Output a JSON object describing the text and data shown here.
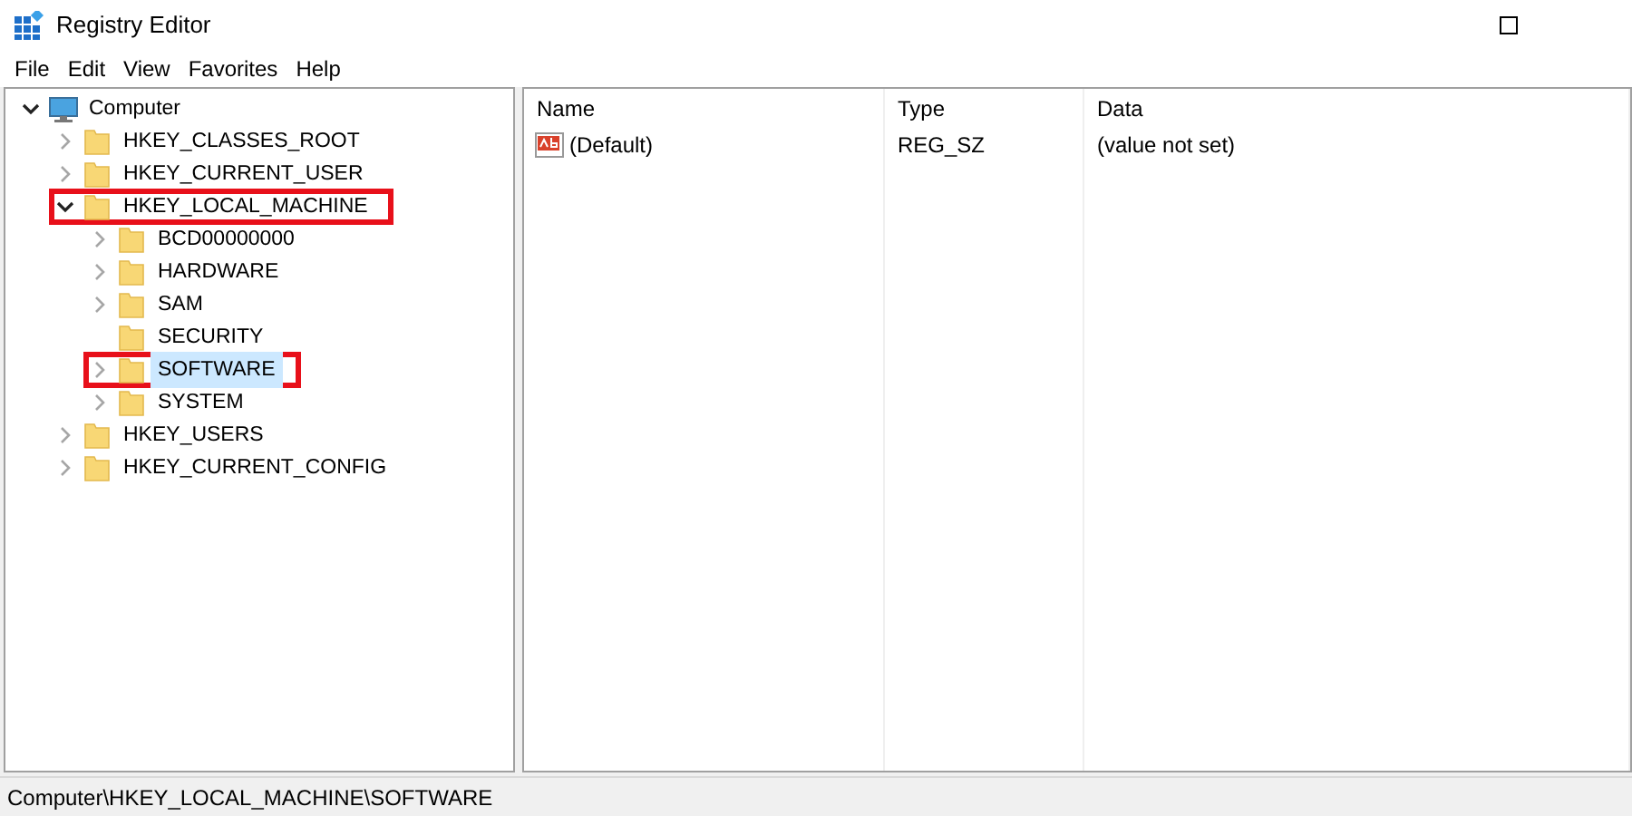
{
  "window": {
    "title": "Registry Editor"
  },
  "menu": [
    "File",
    "Edit",
    "View",
    "Favorites",
    "Help"
  ],
  "tree": [
    {
      "label": "Computer",
      "kind": "computer",
      "expanded": true,
      "selected": false,
      "highlighted": false,
      "children": [
        {
          "label": "HKEY_CLASSES_ROOT",
          "kind": "folder",
          "expanded": false,
          "selected": false,
          "highlighted": false
        },
        {
          "label": "HKEY_CURRENT_USER",
          "kind": "folder",
          "expanded": false,
          "selected": false,
          "highlighted": false
        },
        {
          "label": "HKEY_LOCAL_MACHINE",
          "kind": "folder",
          "expanded": true,
          "selected": false,
          "highlighted": true,
          "children": [
            {
              "label": "BCD00000000",
              "kind": "folder",
              "expanded": false,
              "selected": false,
              "highlighted": false
            },
            {
              "label": "HARDWARE",
              "kind": "folder",
              "expanded": false,
              "selected": false,
              "highlighted": false
            },
            {
              "label": "SAM",
              "kind": "folder",
              "expanded": false,
              "selected": false,
              "highlighted": false
            },
            {
              "label": "SECURITY",
              "kind": "key",
              "expanded": false,
              "selected": false,
              "highlighted": false
            },
            {
              "label": "SOFTWARE",
              "kind": "folder",
              "expanded": false,
              "selected": true,
              "highlighted": true
            },
            {
              "label": "SYSTEM",
              "kind": "folder",
              "expanded": false,
              "selected": false,
              "highlighted": false
            }
          ]
        },
        {
          "label": "HKEY_USERS",
          "kind": "folder",
          "expanded": false,
          "selected": false,
          "highlighted": false
        },
        {
          "label": "HKEY_CURRENT_CONFIG",
          "kind": "folder",
          "expanded": false,
          "selected": false,
          "highlighted": false
        }
      ]
    }
  ],
  "table": {
    "columns": [
      "Name",
      "Type",
      "Data"
    ],
    "rows": [
      {
        "name": "(Default)",
        "type": "REG_SZ",
        "data": "(value not set)"
      }
    ]
  },
  "status_bar": "Computer\\HKEY_LOCAL_MACHINE\\SOFTWARE"
}
